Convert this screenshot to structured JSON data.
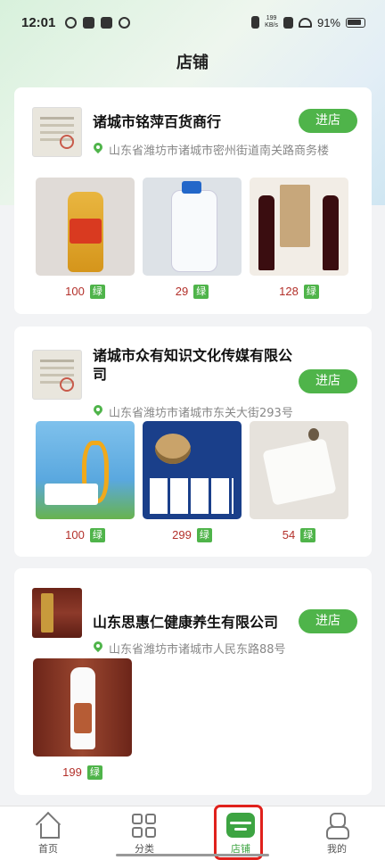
{
  "status_bar": {
    "time": "12:01",
    "net_speed_value": "199",
    "net_speed_unit": "KB/s",
    "battery": "91%"
  },
  "page": {
    "title": "店铺"
  },
  "stores": [
    {
      "name": "诸城市铭萍百货商行",
      "address": "山东省潍坊市诸城市密州街道南关路商务楼",
      "button_label": "进店",
      "products": [
        {
          "price": "100",
          "tag": "绿",
          "icon": "cooking-oil-image"
        },
        {
          "price": "29",
          "tag": "绿",
          "icon": "detergent-image"
        },
        {
          "price": "128",
          "tag": "绿",
          "icon": "red-wine-image"
        }
      ]
    },
    {
      "name": "诸城市众有知识文化传媒有限公司",
      "address": "山东省潍坊市诸城市东关大街293号",
      "button_label": "进店",
      "products": [
        {
          "price": "100",
          "tag": "绿",
          "icon": "goat-milk-powder-image"
        },
        {
          "price": "299",
          "tag": "绿",
          "icon": "eye-care-image"
        },
        {
          "price": "54",
          "tag": "绿",
          "icon": "towel-image"
        }
      ]
    },
    {
      "name": "山东思惠仁健康养生有限公司",
      "address": "山东省潍坊市诸城市人民东路88号",
      "button_label": "进店",
      "products": [
        {
          "price": "199",
          "tag": "绿",
          "icon": "health-roller-image"
        }
      ]
    }
  ],
  "bottom_nav": [
    {
      "label": "首页",
      "icon": "home-icon"
    },
    {
      "label": "分类",
      "icon": "category-grid-icon"
    },
    {
      "label": "店铺",
      "icon": "store-icon",
      "active": true
    },
    {
      "label": "我的",
      "icon": "profile-icon"
    }
  ],
  "colors": {
    "accent": "#4fb44a",
    "price": "#b3302a",
    "highlight": "#e0211c"
  }
}
